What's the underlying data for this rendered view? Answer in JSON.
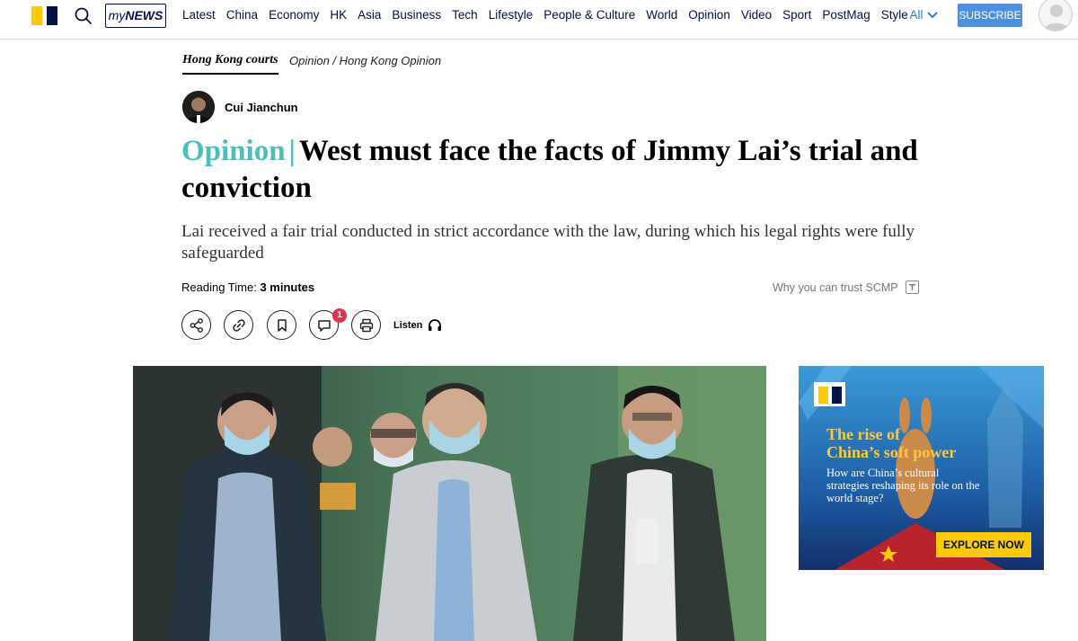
{
  "nav": {
    "mynews_my": "my",
    "mynews_news": "NEWS",
    "items": [
      "Latest",
      "China",
      "Economy",
      "HK",
      "Asia",
      "Business",
      "Tech",
      "Lifestyle",
      "People & Culture",
      "World",
      "Opinion",
      "Video",
      "Sport",
      "PostMag",
      "Style"
    ],
    "all_label": "- All",
    "subscribe_label": "SUBSCRIBE"
  },
  "breadcrumb": {
    "primary": "Hong Kong courts",
    "secondary": "Opinion / Hong Kong Opinion"
  },
  "author": {
    "name": "Cui Jianchun"
  },
  "article": {
    "label": "Opinion",
    "separator": "|",
    "headline": "West must face the facts of Jimmy Lai’s trial and conviction",
    "standfirst": "Lai received a fair trial conducted in strict accordance with the law, during which his legal rights were fully safeguarded",
    "reading_time_label": "Reading Time:",
    "reading_time_value": "3 minutes",
    "trust_text": "Why you can trust SCMP",
    "comment_count": "1",
    "listen_label": "Listen"
  },
  "ad": {
    "title_line1": "The rise of",
    "title_line2": "China’s soft power",
    "text": "How are China’s cultural strategies reshaping its role on the world stage?",
    "cta": "EXPLORE NOW"
  },
  "colors": {
    "brand_navy": "#001246",
    "brand_yellow": "#ffca05",
    "opinion_teal": "#4bbfb9",
    "subscribe_blue": "#4d8fe0",
    "badge_red": "#e2324d"
  }
}
